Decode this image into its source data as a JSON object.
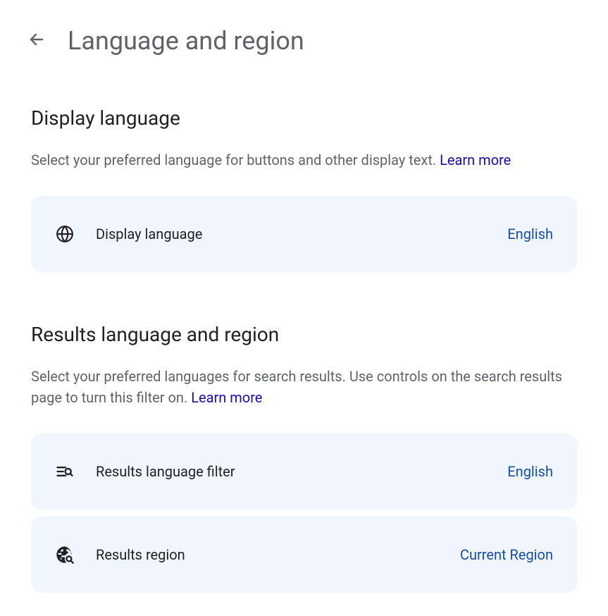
{
  "header": {
    "title": "Language and region"
  },
  "sections": {
    "display_language": {
      "title": "Display language",
      "description": "Select your preferred language for buttons and other display text. ",
      "learn_more": "Learn more",
      "card": {
        "label": "Display language",
        "value": "English"
      }
    },
    "results": {
      "title": "Results language and region",
      "description": "Select your preferred languages for search results. Use controls on the search results page to turn this filter on. ",
      "learn_more": "Learn more",
      "language_card": {
        "label": "Results language filter",
        "value": "English"
      },
      "region_card": {
        "label": "Results region",
        "value": "Current Region"
      }
    }
  }
}
